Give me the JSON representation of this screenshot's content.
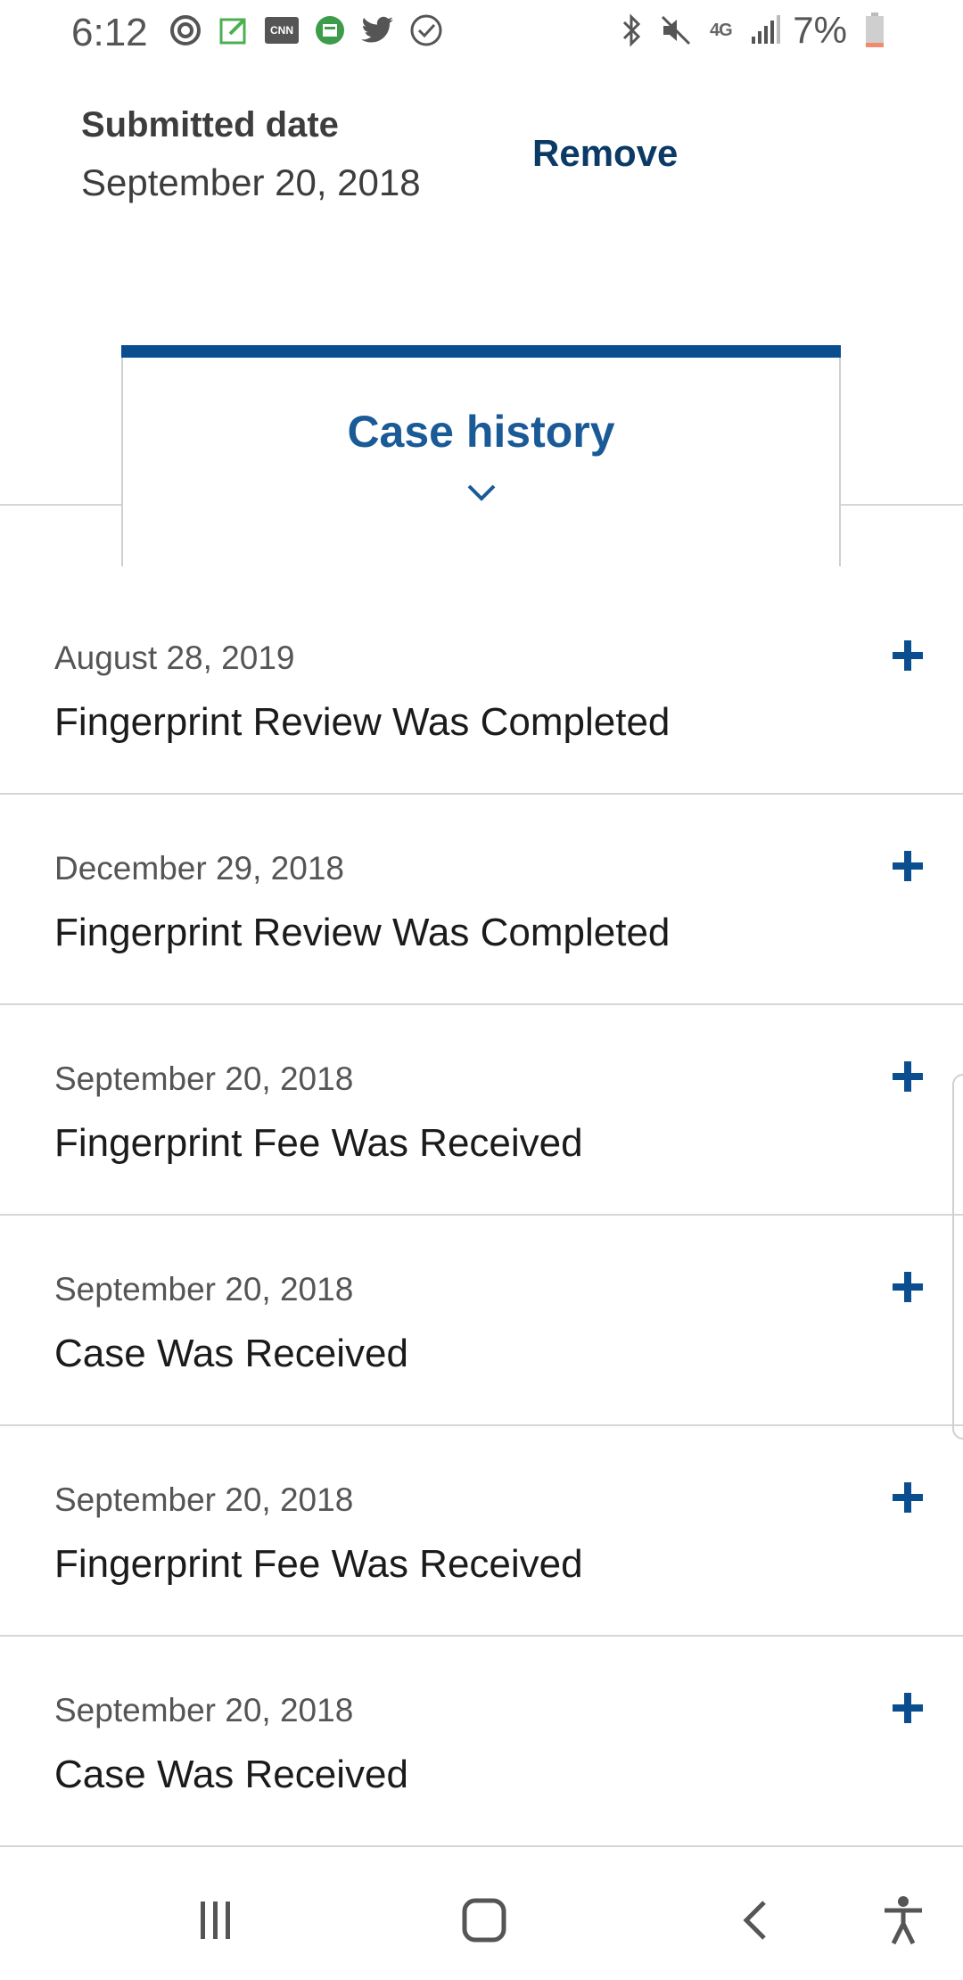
{
  "status_bar": {
    "time": "6:12",
    "network": "4G",
    "battery": "7%",
    "cnn_label": "CNN",
    "left_icons": [
      "activity-icon",
      "notes-icon",
      "cnn-icon",
      "news-icon",
      "twitter-icon",
      "check-circle-icon"
    ],
    "right_icons": [
      "bluetooth-icon",
      "mute-icon",
      "lte-icon",
      "signal-icon",
      "battery-icon"
    ]
  },
  "case_summary": {
    "submitted_label": "Submitted date",
    "submitted_value": "September 20, 2018",
    "remove_label": "Remove"
  },
  "tab": {
    "label": "Case history",
    "active_color": "#0b4e90"
  },
  "history": [
    {
      "date": "August 28, 2019",
      "title": "Fingerprint Review Was Completed"
    },
    {
      "date": "December 29, 2018",
      "title": "Fingerprint Review Was Completed"
    },
    {
      "date": "September 20, 2018",
      "title": "Fingerprint Fee Was Received"
    },
    {
      "date": "September 20, 2018",
      "title": "Case Was Received"
    },
    {
      "date": "September 20, 2018",
      "title": "Fingerprint Fee Was Received"
    },
    {
      "date": "September 20, 2018",
      "title": "Case Was Received"
    }
  ],
  "nav": {
    "buttons": [
      "recent-apps-icon",
      "home-icon",
      "back-icon",
      "accessibility-icon"
    ]
  },
  "colors": {
    "accent": "#0b4e90",
    "text_primary": "#1b1b1b",
    "text_secondary": "#555555"
  }
}
